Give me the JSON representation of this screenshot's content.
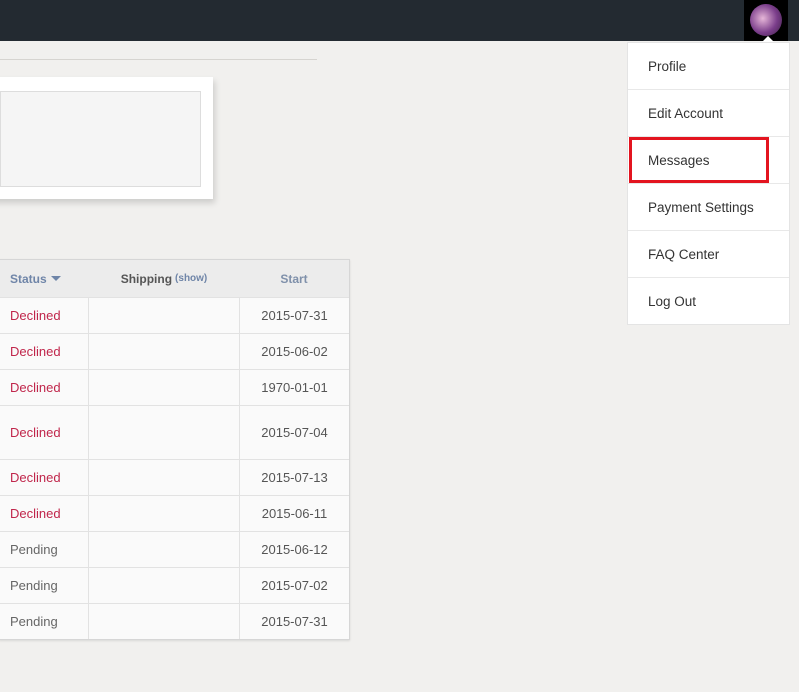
{
  "menu": {
    "items": [
      "Profile",
      "Edit Account",
      "Messages",
      "Payment Settings",
      "FAQ Center",
      "Log Out"
    ],
    "highlighted": "Messages"
  },
  "table": {
    "headers": {
      "status": "Status",
      "shipping": "Shipping",
      "shipping_toggle": "(show)",
      "start": "Start"
    },
    "rows": [
      {
        "status": "Declined",
        "shipping": "",
        "start": "2015-07-31"
      },
      {
        "status": "Declined",
        "shipping": "",
        "start": "2015-06-02"
      },
      {
        "status": "Declined",
        "shipping": "",
        "start": "1970-01-01"
      },
      {
        "status": "Declined",
        "shipping": "",
        "start": "2015-07-04"
      },
      {
        "status": "Declined",
        "shipping": "",
        "start": "2015-07-13"
      },
      {
        "status": "Declined",
        "shipping": "",
        "start": "2015-06-11"
      },
      {
        "status": "Pending",
        "shipping": "",
        "start": "2015-06-12"
      },
      {
        "status": "Pending",
        "shipping": "",
        "start": "2015-07-02"
      },
      {
        "status": "Pending",
        "shipping": "",
        "start": "2015-07-31"
      }
    ]
  },
  "colors": {
    "nav": "#232a31",
    "declined": "#c0264b",
    "highlight": "#e3141f"
  }
}
